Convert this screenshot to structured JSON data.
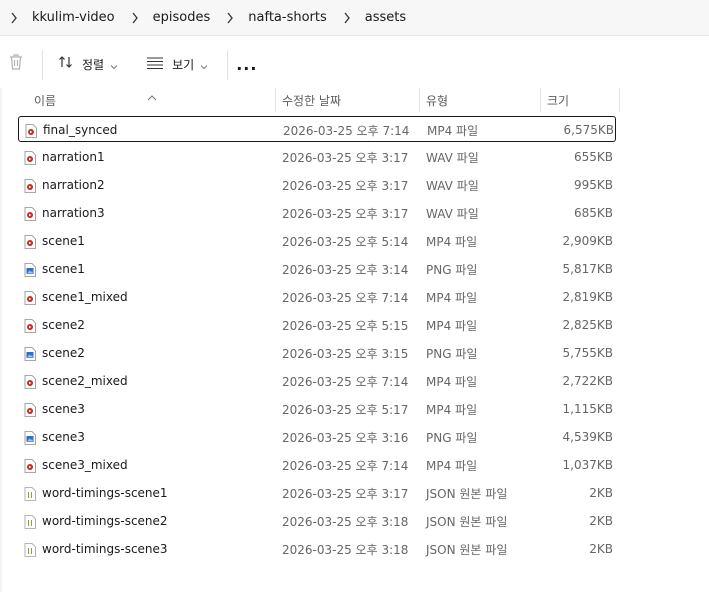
{
  "breadcrumb": [
    "kkulim-video",
    "episodes",
    "nafta-shorts",
    "assets"
  ],
  "toolbar": {
    "sort_label": "정렬",
    "view_label": "보기",
    "more_label": "..."
  },
  "columns": {
    "name": "이름",
    "date": "수정한 날짜",
    "type": "유형",
    "size": "크기"
  },
  "colors": {
    "video_icon": "#c42b1c",
    "image_icon": "#2f6fc4",
    "json_icon": "#7a9a3a",
    "selection_border": "#1a1a1a"
  },
  "files": [
    {
      "name": "final_synced",
      "date": "2026-03-25 오후 7:14",
      "type": "MP4 파일",
      "size": "6,575KB",
      "icon": "video-file-icon",
      "selected": true
    },
    {
      "name": "narration1",
      "date": "2026-03-25 오후 3:17",
      "type": "WAV 파일",
      "size": "655KB",
      "icon": "video-file-icon"
    },
    {
      "name": "narration2",
      "date": "2026-03-25 오후 3:17",
      "type": "WAV 파일",
      "size": "995KB",
      "icon": "video-file-icon"
    },
    {
      "name": "narration3",
      "date": "2026-03-25 오후 3:17",
      "type": "WAV 파일",
      "size": "685KB",
      "icon": "video-file-icon"
    },
    {
      "name": "scene1",
      "date": "2026-03-25 오후 5:14",
      "type": "MP4 파일",
      "size": "2,909KB",
      "icon": "video-file-icon"
    },
    {
      "name": "scene1",
      "date": "2026-03-25 오후 3:14",
      "type": "PNG 파일",
      "size": "5,817KB",
      "icon": "image-file-icon"
    },
    {
      "name": "scene1_mixed",
      "date": "2026-03-25 오후 7:14",
      "type": "MP4 파일",
      "size": "2,819KB",
      "icon": "video-file-icon"
    },
    {
      "name": "scene2",
      "date": "2026-03-25 오후 5:15",
      "type": "MP4 파일",
      "size": "2,825KB",
      "icon": "video-file-icon"
    },
    {
      "name": "scene2",
      "date": "2026-03-25 오후 3:15",
      "type": "PNG 파일",
      "size": "5,755KB",
      "icon": "image-file-icon"
    },
    {
      "name": "scene2_mixed",
      "date": "2026-03-25 오후 7:14",
      "type": "MP4 파일",
      "size": "2,722KB",
      "icon": "video-file-icon"
    },
    {
      "name": "scene3",
      "date": "2026-03-25 오후 5:17",
      "type": "MP4 파일",
      "size": "1,115KB",
      "icon": "video-file-icon"
    },
    {
      "name": "scene3",
      "date": "2026-03-25 오후 3:16",
      "type": "PNG 파일",
      "size": "4,539KB",
      "icon": "image-file-icon"
    },
    {
      "name": "scene3_mixed",
      "date": "2026-03-25 오후 7:14",
      "type": "MP4 파일",
      "size": "1,037KB",
      "icon": "video-file-icon"
    },
    {
      "name": "word-timings-scene1",
      "date": "2026-03-25 오후 3:17",
      "type": "JSON 원본 파일",
      "size": "2KB",
      "icon": "json-file-icon"
    },
    {
      "name": "word-timings-scene2",
      "date": "2026-03-25 오후 3:18",
      "type": "JSON 원본 파일",
      "size": "2KB",
      "icon": "json-file-icon"
    },
    {
      "name": "word-timings-scene3",
      "date": "2026-03-25 오후 3:18",
      "type": "JSON 원본 파일",
      "size": "2KB",
      "icon": "json-file-icon"
    }
  ]
}
